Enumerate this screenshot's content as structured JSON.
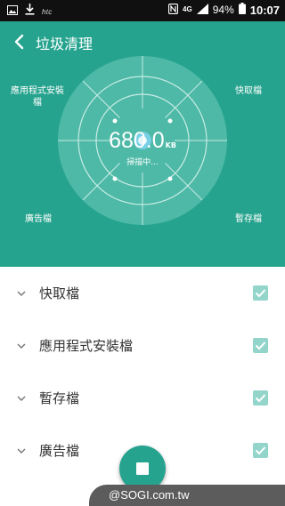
{
  "status_bar": {
    "carrier": "htc",
    "signal_type": "4G",
    "battery": "94%",
    "time": "10:07",
    "icons": [
      "image-icon",
      "download-icon",
      "nfc-icon",
      "signal-icon",
      "battery-icon"
    ]
  },
  "app_bar": {
    "back_icon": "chevron-left-icon",
    "title": "垃圾清理"
  },
  "scan": {
    "size_value": "680.0",
    "size_unit": "KB",
    "status": "掃描中...",
    "corner_labels": {
      "top_left": "應用程式安裝檔",
      "top_right": "快取檔",
      "bottom_left": "廣告檔",
      "bottom_right": "暫存檔"
    }
  },
  "categories": [
    {
      "label": "快取檔",
      "checked": true
    },
    {
      "label": "應用程式安裝檔",
      "checked": true
    },
    {
      "label": "暫存檔",
      "checked": true
    },
    {
      "label": "廣告檔",
      "checked": true
    }
  ],
  "fab": {
    "icon": "stop-icon"
  },
  "watermark": "@SOGI.com.tw",
  "colors": {
    "primary": "#26a38e",
    "checkbox": "#93d5cb",
    "status_bar": "#101010"
  }
}
